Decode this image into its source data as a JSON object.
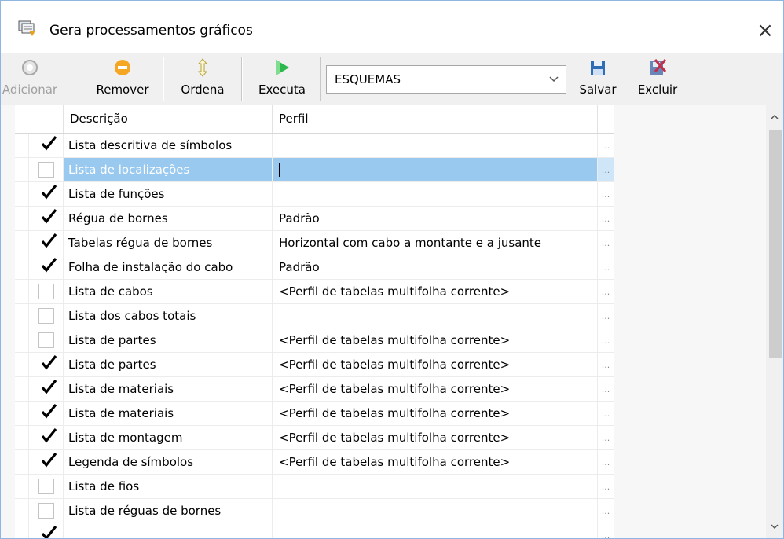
{
  "window": {
    "title": "Gera processamentos gráficos",
    "close": "×"
  },
  "toolbar": {
    "adicionar": "Adicionar",
    "remover": "Remover",
    "ordena": "Ordena",
    "executa": "Executa",
    "combo_value": "ESQUEMAS",
    "salvar": "Salvar",
    "excluir": "Excluir"
  },
  "grid": {
    "headers": {
      "descricao": "Descrição",
      "perfil": "Perfil"
    },
    "rows": [
      {
        "checked": true,
        "descricao": "Lista descritiva de símbolos",
        "perfil": ""
      },
      {
        "checked": false,
        "descricao": "Lista de localizações",
        "perfil": "",
        "selected": true
      },
      {
        "checked": true,
        "descricao": "Lista de funções",
        "perfil": ""
      },
      {
        "checked": true,
        "descricao": "Régua de bornes",
        "perfil": "Padrão"
      },
      {
        "checked": true,
        "descricao": "Tabelas régua de bornes",
        "perfil": "Horizontal com cabo a montante e a jusante"
      },
      {
        "checked": true,
        "descricao": "Folha de instalação do cabo",
        "perfil": "Padrão"
      },
      {
        "checked": false,
        "descricao": "Lista de cabos",
        "perfil": "<Perfil de tabelas multifolha corrente>"
      },
      {
        "checked": false,
        "descricao": "Lista dos cabos totais",
        "perfil": ""
      },
      {
        "checked": false,
        "descricao": "Lista de partes",
        "perfil": "<Perfil de tabelas multifolha corrente>"
      },
      {
        "checked": true,
        "descricao": "Lista de partes",
        "perfil": "<Perfil de tabelas multifolha corrente>"
      },
      {
        "checked": true,
        "descricao": "Lista de materiais",
        "perfil": "<Perfil de tabelas multifolha corrente>"
      },
      {
        "checked": true,
        "descricao": "Lista de materiais",
        "perfil": "<Perfil de tabelas multifolha corrente>"
      },
      {
        "checked": true,
        "descricao": "Lista de montagem",
        "perfil": "<Perfil de tabelas multifolha corrente>"
      },
      {
        "checked": true,
        "descricao": "Legenda de símbolos",
        "perfil": "<Perfil de tabelas multifolha corrente>"
      },
      {
        "checked": false,
        "descricao": "Lista de fios",
        "perfil": ""
      },
      {
        "checked": false,
        "descricao": "Lista de réguas de bornes",
        "perfil": ""
      },
      {
        "checked": true,
        "descricao": "",
        "perfil": ""
      }
    ],
    "dots": "..."
  },
  "icons": {
    "title": "graphics-process-icon",
    "adicionar": "add-circle-icon",
    "remover": "remove-circle-icon",
    "ordena": "sort-arrows-icon",
    "executa": "execute-arrow-icon",
    "salvar": "save-disk-icon",
    "excluir": "delete-icon"
  },
  "colors": {
    "selection": "#99c9ef",
    "remove": "#f5a623",
    "execute": "#2db84d",
    "save": "#2f6db5",
    "delete": "#c0304a"
  }
}
